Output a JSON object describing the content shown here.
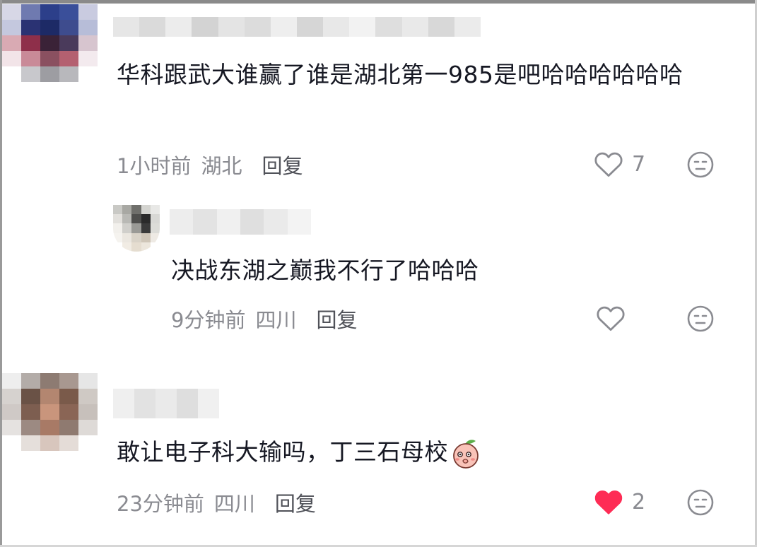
{
  "comments": [
    {
      "text": "华科跟武大谁赢了谁是湖北第一985是吧哈哈哈哈哈哈",
      "time": "1小时前",
      "location": "湖北",
      "reply_label": "回复",
      "like_count": "7",
      "liked": false
    },
    {
      "text": "决战东湖之巅我不行了哈哈哈",
      "time": "9分钟前",
      "location": "四川",
      "reply_label": "回复",
      "like_count": "",
      "liked": false
    },
    {
      "text": "敢让电子科大输吗，丁三石母校",
      "time": "23分钟前",
      "location": "四川",
      "reply_label": "回复",
      "like_count": "2",
      "liked": true
    }
  ],
  "colors": {
    "text": "#161823",
    "meta": "#8a8b91",
    "liked_heart": "#fe2c55"
  },
  "icons": [
    "heart-icon",
    "dislike-face-icon",
    "peach-emoji-icon"
  ]
}
